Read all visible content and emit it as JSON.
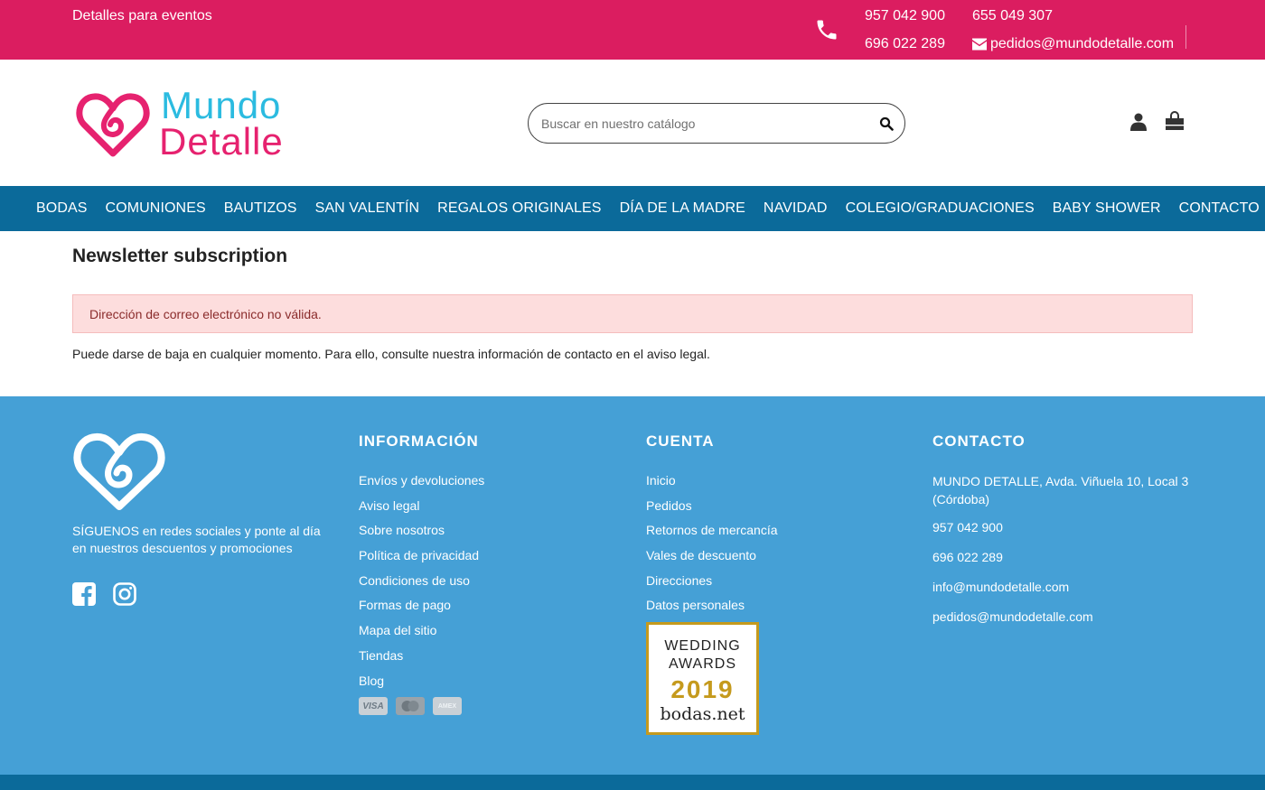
{
  "topbar": {
    "tagline": "Detalles para eventos",
    "phone1": "957 042 900",
    "phone2": "655 049 307",
    "phone3": "696 022 289",
    "email": "pedidos@mundodetalle.com"
  },
  "header": {
    "logo_word1": "Mundo",
    "logo_word2": "Detalle",
    "search_placeholder": "Buscar en nuestro catálogo"
  },
  "nav": [
    "BODAS",
    "COMUNIONES",
    "BAUTIZOS",
    "SAN VALENTÍN",
    "REGALOS ORIGINALES",
    "DÍA DE LA MADRE",
    "NAVIDAD",
    "COLEGIO/GRADUACIONES",
    "BABY SHOWER",
    "CONTACTO"
  ],
  "main": {
    "title": "Newsletter subscription",
    "alert": "Dirección de correo electrónico no válida.",
    "notice": "Puede darse de baja en cualquier momento. Para ello, consulte nuestra información de contacto en el aviso legal."
  },
  "footer": {
    "follow": "SÍGUENOS en redes sociales y ponte al día en nuestros descuentos y promociones",
    "info_title": "INFORMACIÓN",
    "info_links": [
      "Envíos y devoluciones",
      "Aviso legal",
      "Sobre nosotros",
      "Política de privacidad",
      "Condiciones de uso",
      "Formas de pago",
      "Mapa del sitio",
      "Tiendas",
      "Blog"
    ],
    "account_title": "CUENTA",
    "account_links": [
      "Inicio",
      "Pedidos",
      "Retornos de mercancía",
      "Vales de descuento",
      "Direcciones",
      "Datos personales"
    ],
    "contact_title": "CONTACTO",
    "contact_lines": [
      "MUNDO DETALLE, Avda. Viñuela 10, Local 3 (Córdoba)",
      "957 042 900",
      "696 022 289",
      "info@mundodetalle.com",
      "pedidos@mundodetalle.com"
    ],
    "payments": [
      "VISA",
      "AMEX"
    ],
    "award": {
      "line1": "WEDDING",
      "line2": "AWARDS",
      "year": "2019",
      "brand": "bodas.net"
    }
  },
  "colors": {
    "topbar": "#db1d60",
    "nav": "#0b6a9a",
    "footer": "#45a0d6",
    "logo_cyan": "#2bbbe0",
    "logo_pink": "#e6226f",
    "alert_bg": "#fddddd",
    "award_gold": "#c59a1d"
  },
  "icons": [
    "phone-icon",
    "envelope-icon",
    "search-icon",
    "user-icon",
    "shopping-bag-icon",
    "heart-logo-icon",
    "facebook-icon",
    "instagram-icon",
    "mastercard-icon"
  ]
}
